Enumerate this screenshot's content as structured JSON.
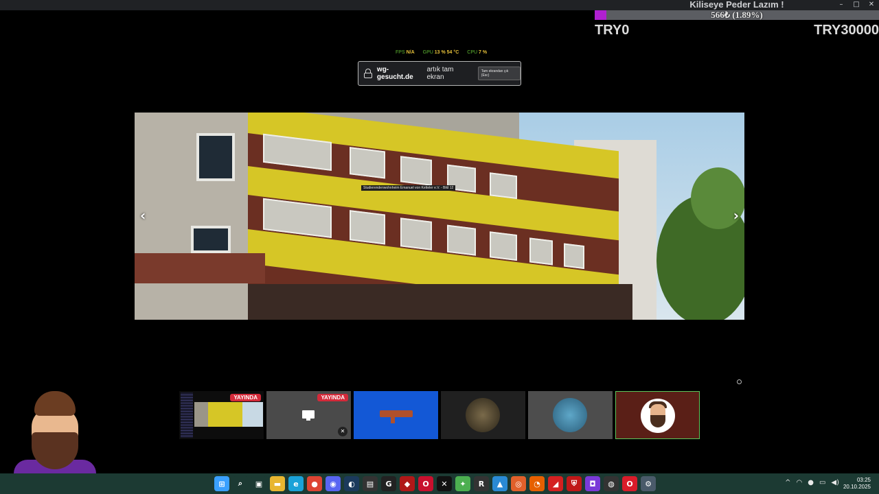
{
  "window": {
    "controls": {
      "minimize": "–",
      "maximize": "□",
      "close": "✕"
    }
  },
  "donation_goal": {
    "title": "Kiliseye Peder Lazım !",
    "progress_text": "566₺ (1.89%)",
    "progress_percent": 1.89,
    "min_label": "TRY0",
    "max_label": "TRY30000",
    "bar_color": "#b020d0"
  },
  "perf_overlay": {
    "fps_label": "FPS",
    "fps_value": "N/A",
    "gpu_label": "GPU",
    "gpu_value": "13 % 54 °C",
    "cpu_label": "CPU",
    "cpu_value": "7 %"
  },
  "fullscreen_notice": {
    "domain": "wg-gesucht.de",
    "text": "artık tam ekran",
    "exit_label": "Tam ekrandan çık (Esc)"
  },
  "gallery": {
    "caption": "Studierendenwohnheim Emanuel von Ketteler e.V. - Bild 12",
    "prev_label": "‹",
    "next_label": "›"
  },
  "tiles": [
    {
      "name": "Screen share with building photo",
      "badge": "YAYINDA"
    },
    {
      "name": "Screen share desktop",
      "badge": "YAYINDA",
      "muted": true
    },
    {
      "name": "Blue avatar with rifle"
    },
    {
      "name": "Dark avatar"
    },
    {
      "name": "Stitch avatar"
    },
    {
      "name": "Bearded man avatar",
      "active": true
    }
  ],
  "taskbar": {
    "icons": [
      {
        "name": "windows-start-icon",
        "glyph": "⊞",
        "color": "#3aa0ff"
      },
      {
        "name": "search-icon",
        "glyph": "⌕",
        "color": "#1c3a33"
      },
      {
        "name": "task-view-icon",
        "glyph": "▣",
        "color": "#1c3a33"
      },
      {
        "name": "file-explorer-icon",
        "glyph": "▬",
        "color": "#e8b630"
      },
      {
        "name": "edge-icon",
        "glyph": "e",
        "color": "#1aa2d8"
      },
      {
        "name": "chrome-icon",
        "glyph": "●",
        "color": "#dd4433"
      },
      {
        "name": "discord-icon",
        "glyph": "◉",
        "color": "#5865f2"
      },
      {
        "name": "steam-icon",
        "glyph": "◐",
        "color": "#1b3a5c"
      },
      {
        "name": "terminal-icon",
        "glyph": "▤",
        "color": "#333"
      },
      {
        "name": "g-app-icon",
        "glyph": "G",
        "color": "#222"
      },
      {
        "name": "red-app-icon",
        "glyph": "◆",
        "color": "#b01818"
      },
      {
        "name": "opera-gx-icon",
        "glyph": "O",
        "color": "#c8102e"
      },
      {
        "name": "capcut-icon",
        "glyph": "✕",
        "color": "#111"
      },
      {
        "name": "green-app-icon",
        "glyph": "✦",
        "color": "#4caf50"
      },
      {
        "name": "r-app-icon",
        "glyph": "R",
        "color": "#333"
      },
      {
        "name": "photos-icon",
        "glyph": "▲",
        "color": "#2a8ad4"
      },
      {
        "name": "orange-app-icon",
        "glyph": "◎",
        "color": "#e0602a"
      },
      {
        "name": "firefox-icon",
        "glyph": "◔",
        "color": "#e66000"
      },
      {
        "name": "red-arrow-app-icon",
        "glyph": "◢",
        "color": "#d42020"
      },
      {
        "name": "shield-app-icon",
        "glyph": "⛨",
        "color": "#c01818"
      },
      {
        "name": "purple-app-icon",
        "glyph": "◘",
        "color": "#7a3ad8"
      },
      {
        "name": "obs-icon",
        "glyph": "◍",
        "color": "#333"
      },
      {
        "name": "opera-icon",
        "glyph": "O",
        "color": "#d81c2a"
      },
      {
        "name": "settings-icon",
        "glyph": "⚙",
        "color": "#4a5a6a"
      }
    ],
    "tray": {
      "chevron": "^",
      "wifi": "◠",
      "mic": "●",
      "display": "▭",
      "volume": "◀)"
    },
    "time": "03:25",
    "date": "20.10.2025"
  }
}
